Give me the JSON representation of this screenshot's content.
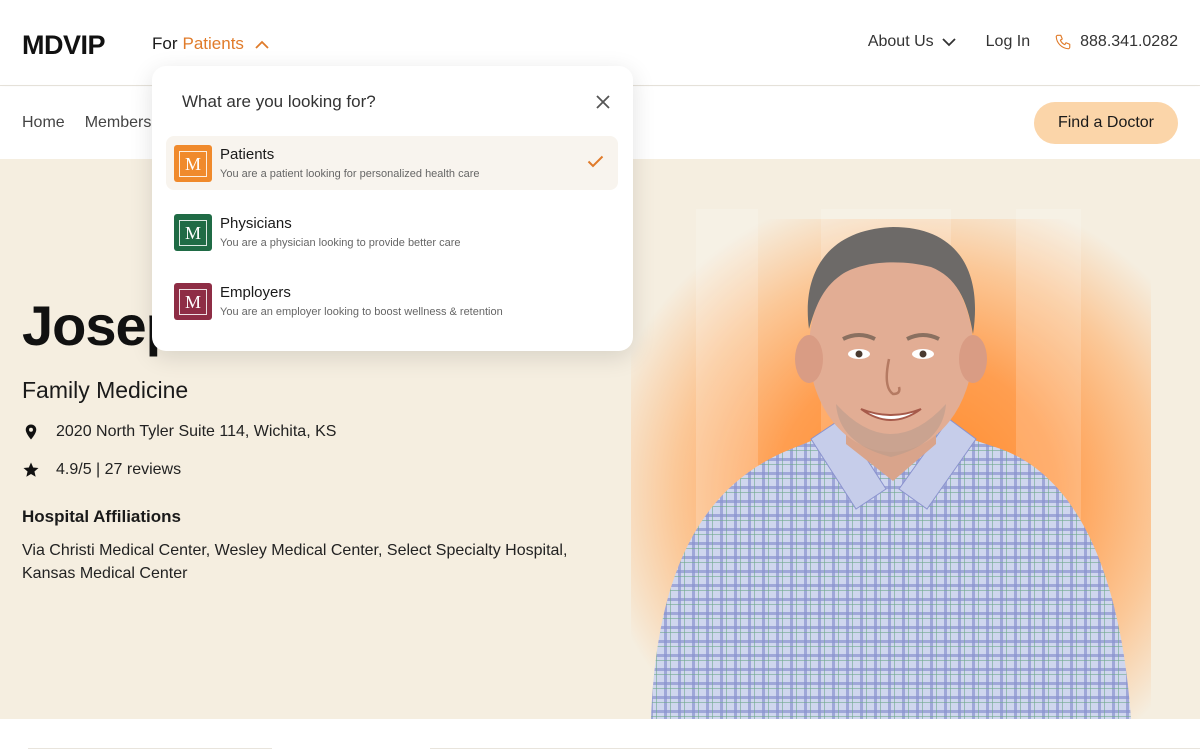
{
  "header": {
    "logo": "MDVIP",
    "for_label": "For",
    "audience": "Patients",
    "about_label": "About Us",
    "login_label": "Log In",
    "phone": "888.341.0282"
  },
  "subnav": {
    "links": [
      "Home",
      "Members"
    ],
    "cta_label": "Find a Doctor"
  },
  "dropdown": {
    "question": "What are you looking for?",
    "options": [
      {
        "title": "Patients",
        "subtitle": "You are a patient looking for personalized health care",
        "color": "#f08a2c",
        "selected": true
      },
      {
        "title": "Physicians",
        "subtitle": "You are a physician looking to provide better care",
        "color": "#1f6b45",
        "selected": false
      },
      {
        "title": "Employers",
        "subtitle": "You are an employer looking to boost wellness & retention",
        "color": "#8e2d45",
        "selected": false
      }
    ],
    "badge_letter": "M"
  },
  "doctor": {
    "name": "Josep",
    "specialty": "Family Medicine",
    "address": "2020 North Tyler Suite 114, Wichita, KS",
    "rating": "4.9/5 | 27 reviews",
    "affiliations_title": "Hospital Affiliations",
    "affiliations": "Via Christi Medical Center, Wesley Medical Center, Select Specialty Hospital, Kansas Medical Center"
  },
  "colors": {
    "accent": "#e07b2a",
    "hero_bg": "#f5eee0",
    "cta_bg": "#fbd5a9"
  }
}
